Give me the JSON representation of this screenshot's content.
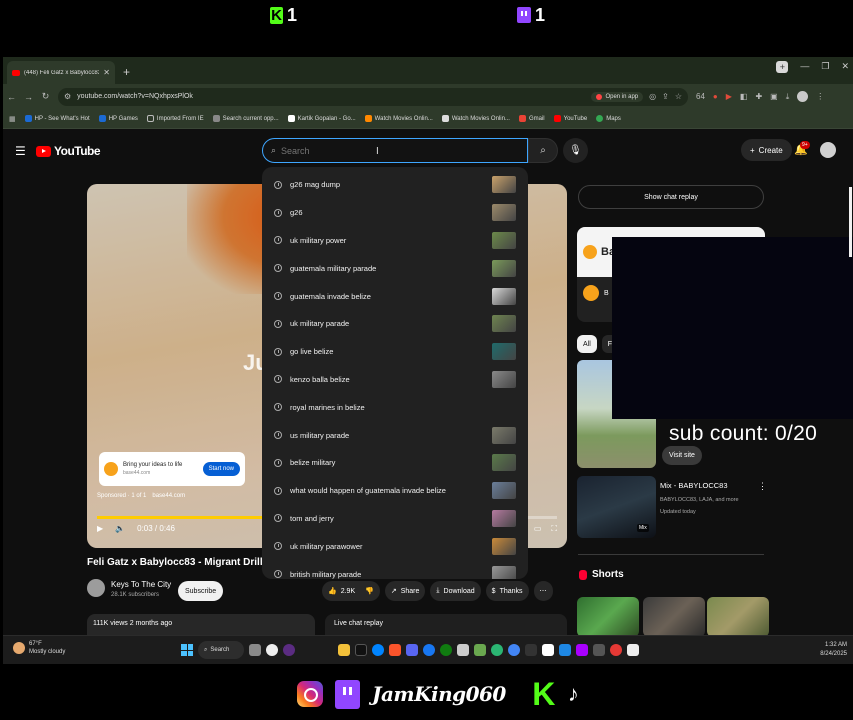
{
  "overlay": {
    "kick_count": "1",
    "twitch_count": "1",
    "handle": "JamKing060",
    "kick_logo": "K",
    "tiktok_glyph": "♪"
  },
  "browser": {
    "tab_title": "(448) Feli Gatz x Babylocc83 - M",
    "url": "youtube.com/watch?v=NQxhpxsPlOk",
    "open_in_app": "Open in app",
    "ext_badge": "64",
    "bookmarks": [
      "HP - See What's Hot",
      "HP Games",
      "Imported From IE",
      "Search current opp...",
      "Kartik Gopalan - Go...",
      "Watch Movies Onlin...",
      "Watch Movies Onlin...",
      "Gmail",
      "YouTube",
      "Maps"
    ]
  },
  "yt": {
    "logo_text": "YouTube",
    "search_placeholder": "Search",
    "create_label": "Create",
    "notif_badge": "9+",
    "suggestions": [
      "g26 mag dump",
      "g26",
      "uk military power",
      "guatemala military parade",
      "guatemala invade belize",
      "uk military parade",
      "go live belize",
      "kenzo balla belize",
      "royal marines in belize",
      "us military parade",
      "belize military",
      "what would happen of guatemala invade belize",
      "tom and jerry",
      "uk military parawower",
      "british military parade"
    ],
    "player": {
      "big_text": "Ju",
      "ad_title": "Bring your ideas to life",
      "ad_domain": "base44.com",
      "ad_button": "Start now",
      "sponsored": "Sponsored · 1 of 1",
      "sponsored_domain": "base44.com",
      "time": "0:03 / 0:46",
      "progress_fraction": 0.72
    },
    "video_title": "Feli Gatz x Babylocc83 - Migrant Drill (Sho",
    "channel_name": "Keys To The City",
    "channel_subs": "28.1K subscribers",
    "subscribe_label": "Subscribe",
    "likes": "2.9K",
    "share_label": "Share",
    "download_label": "Download",
    "thanks_label": "Thanks",
    "views": "111K views  2 months ago",
    "live_chat": "Live chat replay",
    "show_chat_replay": "Show chat replay",
    "ad_panel_name": "Ba",
    "ad_panel_row": "B",
    "chip_all": "All",
    "chip_fr": "Fr",
    "sub_count": "sub count:  0/20",
    "visit_site": "Visit site",
    "mix_title": "Mix - BABYLOCC83",
    "mix_meta1": "BABYLOCC83, LAJA, and more",
    "mix_meta2": "Updated today",
    "mix_badge": "Mix",
    "shorts_label": "Shorts"
  },
  "taskbar": {
    "temp": "67°F",
    "weather": "Mostly cloudy",
    "search": "Search",
    "time": "1:32 AM",
    "date": "8/24/2025"
  },
  "colors": {
    "accent_red": "#ff0000",
    "kick_green": "#53fc18",
    "twitch_purple": "#9146ff",
    "search_focus": "#3ea6ff"
  }
}
